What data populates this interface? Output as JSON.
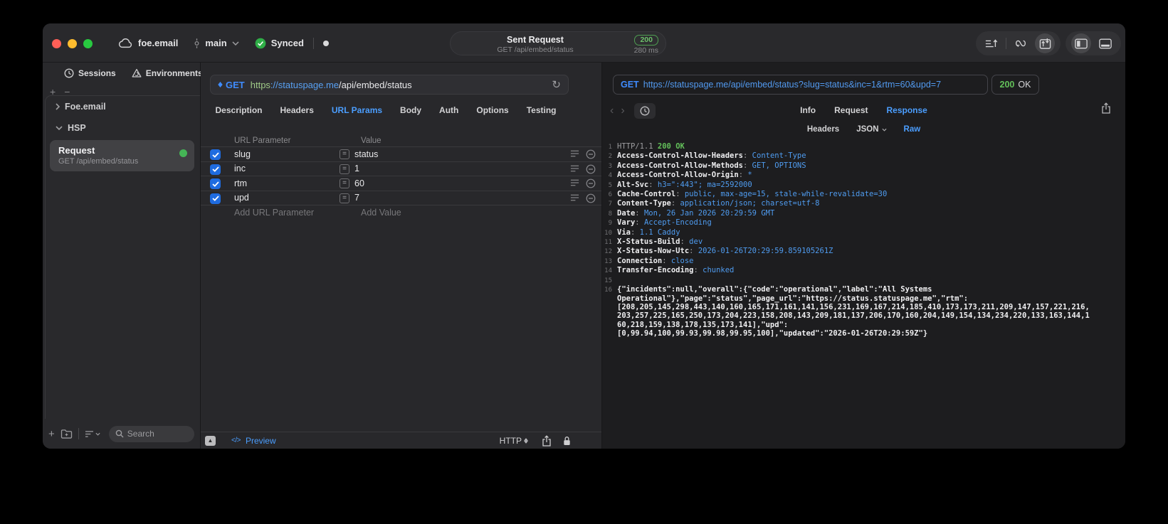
{
  "titlebar": {
    "project": "foe.email",
    "branch": "main",
    "sync_label": "Synced",
    "request_title": "Sent Request",
    "request_subtitle": "GET /api/embed/status",
    "status_code": "200",
    "duration": "280 ms"
  },
  "colors": {
    "accent_blue": "#4b9eff",
    "status_green": "#63c05a",
    "traffic_red": "#ff5f57",
    "traffic_yellow": "#febc2e",
    "traffic_green": "#28c840"
  },
  "sidebar": {
    "tabs": {
      "sessions": "Sessions",
      "environments": "Environments"
    },
    "tree": {
      "item1": "Foe.email",
      "item2": "HSP"
    },
    "request_item": {
      "title": "Request",
      "subtitle": "GET /api/embed/status"
    },
    "search_placeholder": "Search"
  },
  "editor": {
    "method": "GET",
    "url_scheme": "https",
    "url_host": "://statuspage.me",
    "url_path": "/api/embed/status",
    "tabs": [
      "Description",
      "Headers",
      "URL Params",
      "Body",
      "Auth",
      "Options",
      "Testing"
    ],
    "active_tab": "URL Params",
    "table": {
      "col_name": "URL Parameter",
      "col_value": "Value",
      "operator": "=",
      "rows": [
        {
          "name": "slug",
          "value": "status",
          "enabled": true
        },
        {
          "name": "inc",
          "value": "1",
          "enabled": true
        },
        {
          "name": "rtm",
          "value": "60",
          "enabled": true
        },
        {
          "name": "upd",
          "value": "7",
          "enabled": true
        }
      ],
      "add_name": "Add URL Parameter",
      "add_value": "Add Value"
    },
    "footer": {
      "code_glyph": "</>",
      "preview": "Preview",
      "protocol": "HTTP"
    }
  },
  "response": {
    "method": "GET",
    "url": "https://statuspage.me/api/embed/status?slug=status&inc=1&rtm=60&upd=7",
    "status_code": "200",
    "status_text": "OK",
    "tabs": [
      "Info",
      "Request",
      "Response"
    ],
    "active_tab": "Response",
    "subtabs": [
      "Headers",
      "JSON",
      "Raw"
    ],
    "active_subtab": "Raw",
    "lines": [
      {
        "num": "1",
        "segments": [
          {
            "t": "HTTP/1.1 ",
            "c": "p"
          },
          {
            "t": "200 OK",
            "c": "g"
          }
        ]
      },
      {
        "num": "2",
        "segments": [
          {
            "t": "Access-Control-Allow-Headers",
            "c": "k"
          },
          {
            "t": ": ",
            "c": "p"
          },
          {
            "t": "Content-Type",
            "c": "v"
          }
        ]
      },
      {
        "num": "3",
        "segments": [
          {
            "t": "Access-Control-Allow-Methods",
            "c": "k"
          },
          {
            "t": ": ",
            "c": "p"
          },
          {
            "t": "GET, OPTIONS",
            "c": "v"
          }
        ]
      },
      {
        "num": "4",
        "segments": [
          {
            "t": "Access-Control-Allow-Origin",
            "c": "k"
          },
          {
            "t": ": ",
            "c": "p"
          },
          {
            "t": "*",
            "c": "v"
          }
        ]
      },
      {
        "num": "5",
        "segments": [
          {
            "t": "Alt-Svc",
            "c": "k"
          },
          {
            "t": ": ",
            "c": "p"
          },
          {
            "t": "h3=\":443\"; ma=2592000",
            "c": "v"
          }
        ]
      },
      {
        "num": "6",
        "segments": [
          {
            "t": "Cache-Control",
            "c": "k"
          },
          {
            "t": ": ",
            "c": "p"
          },
          {
            "t": "public, max-age=15, stale-while-revalidate=30",
            "c": "v"
          }
        ]
      },
      {
        "num": "7",
        "segments": [
          {
            "t": "Content-Type",
            "c": "k"
          },
          {
            "t": ": ",
            "c": "p"
          },
          {
            "t": "application/json; charset=utf-8",
            "c": "v"
          }
        ]
      },
      {
        "num": "8",
        "segments": [
          {
            "t": "Date",
            "c": "k"
          },
          {
            "t": ": ",
            "c": "p"
          },
          {
            "t": "Mon, 26 Jan 2026 20:29:59 GMT",
            "c": "v"
          }
        ]
      },
      {
        "num": "9",
        "segments": [
          {
            "t": "Vary",
            "c": "k"
          },
          {
            "t": ": ",
            "c": "p"
          },
          {
            "t": "Accept-Encoding",
            "c": "v"
          }
        ]
      },
      {
        "num": "10",
        "segments": [
          {
            "t": "Via",
            "c": "k"
          },
          {
            "t": ": ",
            "c": "p"
          },
          {
            "t": "1.1 Caddy",
            "c": "v"
          }
        ]
      },
      {
        "num": "11",
        "segments": [
          {
            "t": "X-Status-Build",
            "c": "k"
          },
          {
            "t": ": ",
            "c": "p"
          },
          {
            "t": "dev",
            "c": "v"
          }
        ]
      },
      {
        "num": "12",
        "segments": [
          {
            "t": "X-Status-Now-Utc",
            "c": "k"
          },
          {
            "t": ": ",
            "c": "p"
          },
          {
            "t": "2026-01-26T20:29:59.859105261Z",
            "c": "v"
          }
        ]
      },
      {
        "num": "13",
        "segments": [
          {
            "t": "Connection",
            "c": "k"
          },
          {
            "t": ": ",
            "c": "p"
          },
          {
            "t": "close",
            "c": "v"
          }
        ]
      },
      {
        "num": "14",
        "segments": [
          {
            "t": "Transfer-Encoding",
            "c": "k"
          },
          {
            "t": ": ",
            "c": "p"
          },
          {
            "t": "chunked",
            "c": "v"
          }
        ]
      },
      {
        "num": "15",
        "segments": []
      },
      {
        "num": "16",
        "segments": [
          {
            "t": "{\"incidents\":null,\"overall\":{\"code\":\"operational\",\"label\":\"All Systems\nOperational\"},\"page\":\"status\",\"page_url\":\"https://status.statuspage.me\",\"rtm\":\n[208,205,145,298,443,140,160,165,171,161,141,156,231,169,167,214,185,410,173,173,211,209,147,157,221,216,\n203,257,225,165,250,173,204,223,158,208,143,209,181,137,206,170,160,204,149,154,134,234,220,133,163,144,1\n60,218,159,138,178,135,173,141],\"upd\":\n[0,99.94,100,99.93,99.98,99.95,100],\"updated\":\"2026-01-26T20:29:59Z\"}",
            "c": "b"
          }
        ]
      }
    ]
  }
}
